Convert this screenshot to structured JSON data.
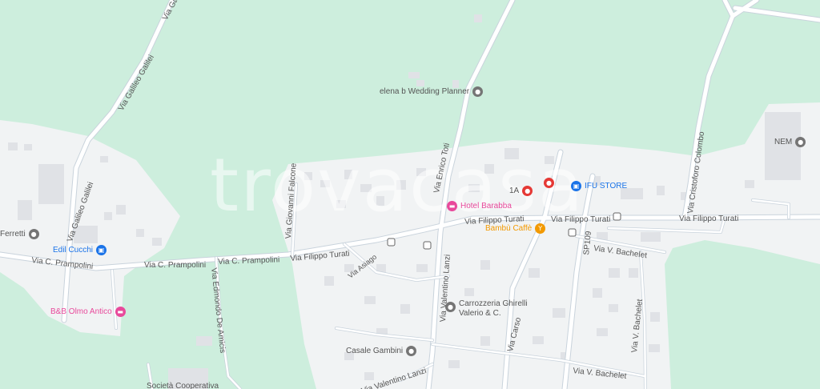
{
  "watermark": "trovacasa",
  "colors": {
    "land": "#cdeedd",
    "urban": "#f1f3f4",
    "road": "#ffffff",
    "road_casing": "#c9d3dc",
    "building": "#e0e2e6",
    "poi_gray": "#757575",
    "poi_pink": "#e8499b",
    "poi_blue": "#1a73e8",
    "poi_orange": "#f29900",
    "poi_red": "#e53935"
  },
  "streets": {
    "via_galilei_top": "Via Galilei",
    "via_galileo_galilei_1": "Via Galileo Galilei",
    "via_galileo_galilei_2": "Via Galileo Galilei",
    "via_c_prampolini_1": "Via C. Prampolini",
    "via_c_prampolini_2": "Via C. Prampolini",
    "via_c_prampolini_3": "Via C. Prampolini",
    "via_filippo_turati_1": "Via Filippo Turati",
    "via_filippo_turati_2": "Via Filippo Turati",
    "via_filippo_turati_3": "Via Filippo Turati",
    "via_filippo_turati_4": "Via Filippo Turati",
    "via_enrico_toti": "Via Enrico Toti",
    "via_giovanni_falcone": "Via Giovanni Falcone",
    "via_cristoforo_colombo": "Via Cristoforo Colombo",
    "via_carso": "Via Carso",
    "sp109": "SP109",
    "via_v_bachelet_1": "Via V. Bachelet",
    "via_v_bachelet_2": "Via V. Bachelet",
    "via_v_bachelet_3": "Via V. Bachelet",
    "via_valentino_lanzi_1": "Via Valentino Lanzi",
    "via_valentino_lanzi_2": "Via Valentino Lanzi",
    "via_edmondo_de_amicis": "Via Edmondo De Amicis",
    "via_asiago": "Via Asiago"
  },
  "pois": {
    "elena_b": {
      "label": "elena b Wedding Planner",
      "icon": "place-icon"
    },
    "nem": {
      "label": "NEM",
      "icon": "place-icon"
    },
    "hotel_barabba": {
      "label": "Hotel Barabba",
      "icon": "bed-icon"
    },
    "ifu_store": {
      "label": "IFU STORE",
      "icon": "shopping-bag-icon"
    },
    "bambu_caffe": {
      "label": "Bambù Caffè",
      "icon": "cafe-icon"
    },
    "ferretti": {
      "label": "Ferretti",
      "icon": "place-icon"
    },
    "edil_cucchi": {
      "label": "Edil Cucchi",
      "icon": "shopping-bag-icon"
    },
    "bb_olmo_antico": {
      "label": "B&B Olmo Antico",
      "icon": "bed-icon"
    },
    "carrozzeria_line1": "Carrozzeria Ghirelli",
    "carrozzeria_line2": "Valerio & C.",
    "casale_gambini": {
      "label": "Casale Gambini",
      "icon": "place-icon"
    },
    "societa_cooperativa": {
      "label": "Società Cooperativa"
    },
    "marker_1a": {
      "label": "1A",
      "icon": "location-pin-icon"
    }
  }
}
